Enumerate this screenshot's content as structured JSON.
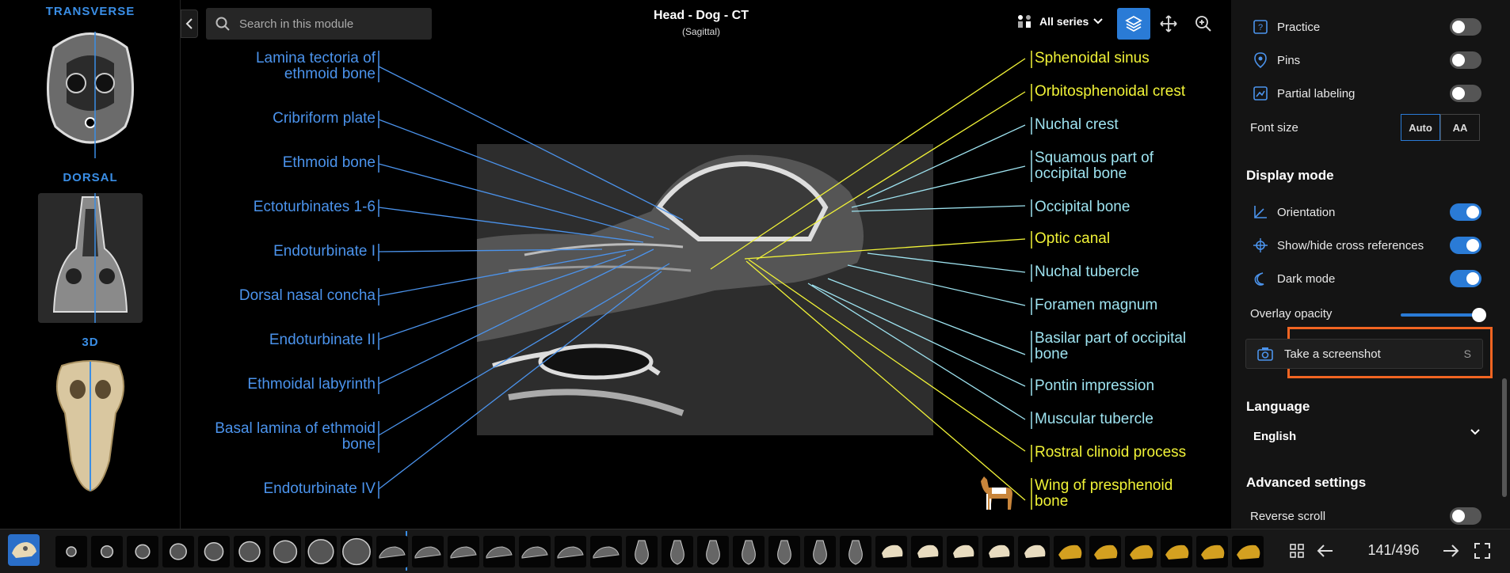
{
  "left_panel": {
    "sections": [
      {
        "label": "TRANSVERSE"
      },
      {
        "label": "DORSAL"
      },
      {
        "label": "3D"
      }
    ]
  },
  "search": {
    "placeholder": "Search in this module"
  },
  "header": {
    "title": "Head - Dog - CT",
    "subtitle": "(Sagittal)",
    "series_label": "All series"
  },
  "labels_left": [
    "Lamina tectoria of",
    "ethmoid bone",
    "Cribriform plate",
    "Ethmoid bone",
    "Ectoturbinates 1-6",
    "Endoturbinate I",
    "Dorsal nasal concha",
    "Endoturbinate II",
    "Ethmoidal labyrinth",
    "Basal lamina of ethmoid",
    "bone",
    "Endoturbinate IV"
  ],
  "labels_right": [
    "Sphenoidal sinus",
    "Orbitosphenoidal crest",
    "Nuchal crest",
    "Squamous part of",
    "occipital bone",
    "Occipital bone",
    "Optic canal",
    "Nuchal tubercle",
    "Foramen magnum",
    "Basilar part of occipital",
    "bone",
    "Pontin impression",
    "Muscular tubercle",
    "Rostral clinoid process",
    "Wing of presphenoid",
    "bone"
  ],
  "label_colors": {
    "left": "#4b93ec",
    "yellow": "#f1f337",
    "cyan": "#9ee3f0"
  },
  "settings": {
    "practice": "Practice",
    "pins": "Pins",
    "partial_labeling": "Partial labeling",
    "font_size": "Font size",
    "font_auto": "Auto",
    "font_aa": "AA",
    "display_mode": "Display mode",
    "orientation": "Orientation",
    "cross_refs": "Show/hide cross references",
    "dark_mode": "Dark mode",
    "overlay_opacity": "Overlay opacity",
    "screenshot": "Take a screenshot",
    "screenshot_key": "S",
    "language": "Language",
    "language_value": "English",
    "advanced": "Advanced settings",
    "reverse_scroll": "Reverse scroll"
  },
  "toggles": {
    "practice": false,
    "pins": false,
    "partial_labeling": false,
    "orientation": true,
    "cross_refs": true,
    "dark_mode": true,
    "reverse_scroll": false
  },
  "overlay_opacity": 1.0,
  "navigation": {
    "counter": "141/496"
  },
  "accent": "#2a7bd6",
  "highlight": "#f26522"
}
